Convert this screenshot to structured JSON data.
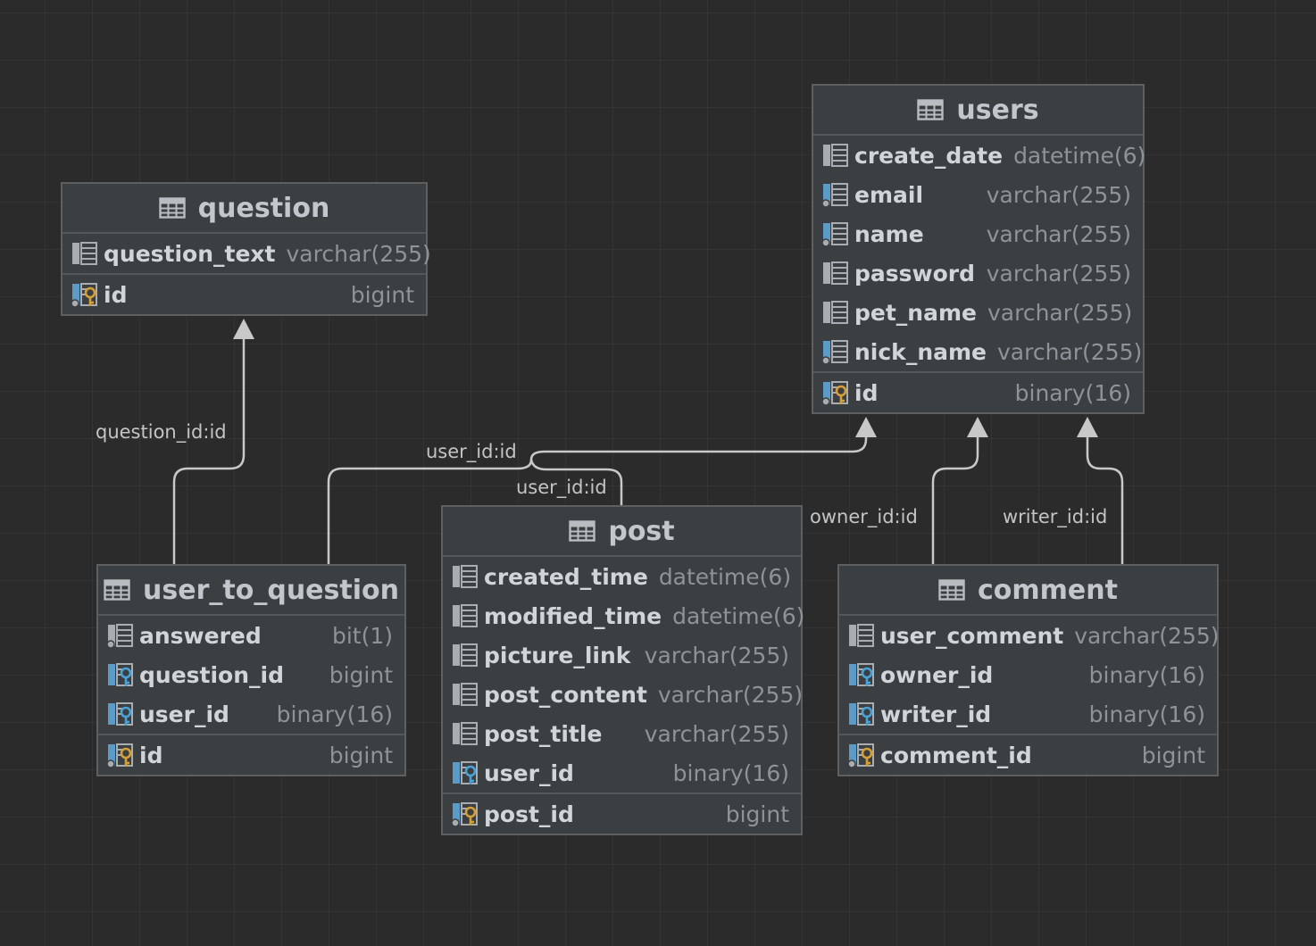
{
  "entities": {
    "question": {
      "name": "question",
      "columns": [
        {
          "name": "question_text",
          "type": "varchar(255)",
          "icon": "column-icon"
        }
      ],
      "pk": {
        "name": "id",
        "type": "bigint",
        "icon": "primary-key-icon"
      }
    },
    "users": {
      "name": "users",
      "columns": [
        {
          "name": "create_date",
          "type": "datetime(6)",
          "icon": "column-icon"
        },
        {
          "name": "email",
          "type": "varchar(255)",
          "icon": "unique-column-icon"
        },
        {
          "name": "name",
          "type": "varchar(255)",
          "icon": "unique-column-icon"
        },
        {
          "name": "password",
          "type": "varchar(255)",
          "icon": "column-icon"
        },
        {
          "name": "pet_name",
          "type": "varchar(255)",
          "icon": "column-icon"
        },
        {
          "name": "nick_name",
          "type": "varchar(255)",
          "icon": "unique-column-icon"
        }
      ],
      "pk": {
        "name": "id",
        "type": "binary(16)",
        "icon": "primary-key-icon"
      }
    },
    "user_to_question": {
      "name": "user_to_question",
      "columns": [
        {
          "name": "answered",
          "type": "bit(1)",
          "icon": "not-null-column-icon"
        },
        {
          "name": "question_id",
          "type": "bigint",
          "icon": "foreign-key-icon"
        },
        {
          "name": "user_id",
          "type": "binary(16)",
          "icon": "foreign-key-icon"
        }
      ],
      "pk": {
        "name": "id",
        "type": "bigint",
        "icon": "primary-key-icon"
      }
    },
    "post": {
      "name": "post",
      "columns": [
        {
          "name": "created_time",
          "type": "datetime(6)",
          "icon": "column-icon"
        },
        {
          "name": "modified_time",
          "type": "datetime(6)",
          "icon": "column-icon"
        },
        {
          "name": "picture_link",
          "type": "varchar(255)",
          "icon": "column-icon"
        },
        {
          "name": "post_content",
          "type": "varchar(255)",
          "icon": "column-icon"
        },
        {
          "name": "post_title",
          "type": "varchar(255)",
          "icon": "column-icon"
        },
        {
          "name": "user_id",
          "type": "binary(16)",
          "icon": "foreign-key-icon"
        }
      ],
      "pk": {
        "name": "post_id",
        "type": "bigint",
        "icon": "primary-key-icon"
      }
    },
    "comment": {
      "name": "comment",
      "columns": [
        {
          "name": "user_comment",
          "type": "varchar(255)",
          "icon": "column-icon"
        },
        {
          "name": "owner_id",
          "type": "binary(16)",
          "icon": "foreign-key-icon"
        },
        {
          "name": "writer_id",
          "type": "binary(16)",
          "icon": "foreign-key-icon"
        }
      ],
      "pk": {
        "name": "comment_id",
        "type": "bigint",
        "icon": "primary-key-icon"
      }
    }
  },
  "relations": [
    {
      "from": "user_to_question",
      "to": "question",
      "label": "question_id:id"
    },
    {
      "from": "user_to_question",
      "to": "users",
      "label": "user_id:id"
    },
    {
      "from": "post",
      "to": "users",
      "label": "user_id:id"
    },
    {
      "from": "comment",
      "to": "users",
      "label": "owner_id:id"
    },
    {
      "from": "comment",
      "to": "users",
      "label": "writer_id:id"
    }
  ],
  "colors": {
    "background": "#2b2b2b",
    "entity_fill": "#3c3f41",
    "connector": "#c8c8c8",
    "key_gold": "#d6a036",
    "key_blue": "#4aa3d8"
  }
}
